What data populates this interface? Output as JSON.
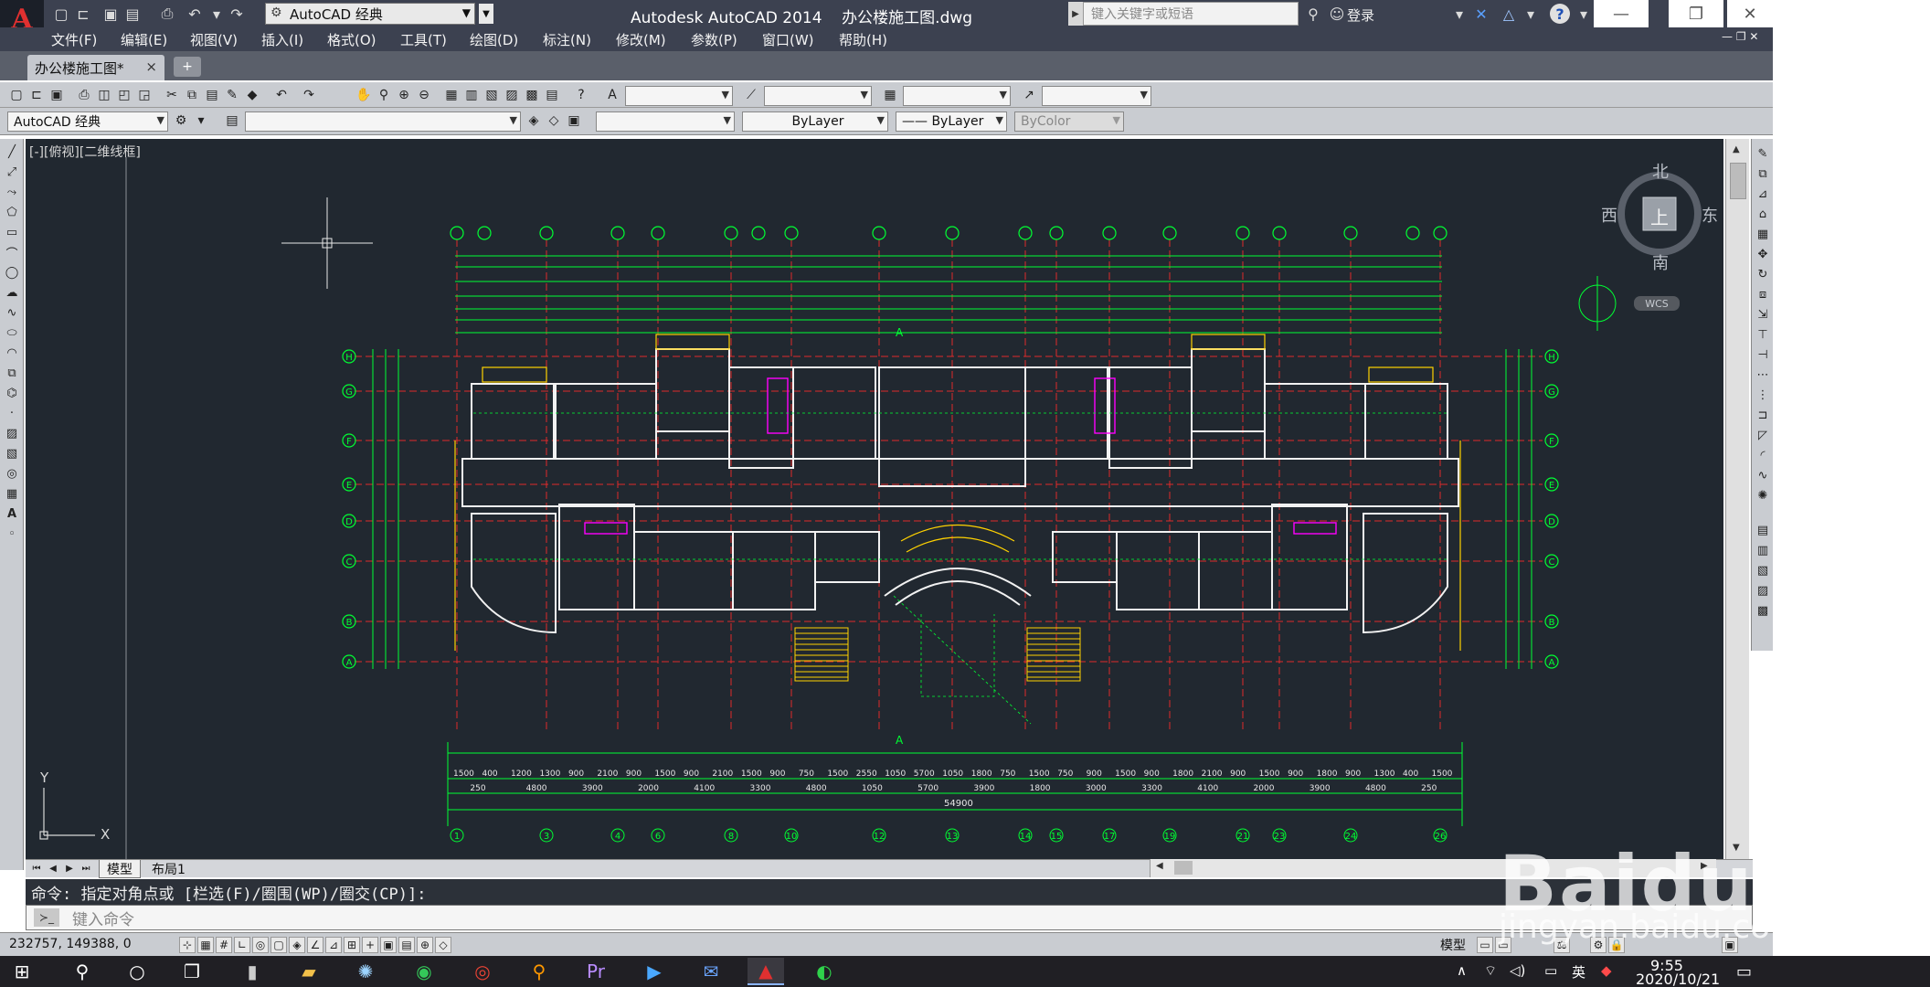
{
  "app": {
    "logo_letter": "A",
    "title": "Autodesk AutoCAD 2014    办公楼施工图.dwg",
    "workspace": "AutoCAD 经典",
    "search_placeholder": "键入关键字或短语",
    "login_label": "登录"
  },
  "menu": [
    "文件(F)",
    "编辑(E)",
    "视图(V)",
    "插入(I)",
    "格式(O)",
    "工具(T)",
    "绘图(D)",
    "标注(N)",
    "修改(M)",
    "参数(P)",
    "窗口(W)",
    "帮助(H)"
  ],
  "document_tab": {
    "name": "办公楼施工图*",
    "close": "×",
    "new_tab": "+"
  },
  "toolbar2": {
    "workspace": "AutoCAD 经典",
    "layer": "",
    "color": "",
    "linetype": "ByLayer",
    "lineweight": "—— ByLayer",
    "plotstyle": "ByColor"
  },
  "viewport": {
    "label": "[-][俯视][二维线框]",
    "compass": {
      "north": "北",
      "south": "南",
      "east": "东",
      "west": "西",
      "top": "上",
      "wcs": "WCS"
    },
    "ucs": {
      "x": "X",
      "y": "Y"
    }
  },
  "drawing": {
    "dim_row1": [
      "1500",
      "400",
      "1200",
      "1300",
      "900",
      "2100",
      "900",
      "1500",
      "900",
      "2100",
      "1500",
      "900",
      "750",
      "1500",
      "2550",
      "1050",
      "5700",
      "1050",
      "1800",
      "750",
      "1500",
      "750",
      "900",
      "1500",
      "900",
      "1800",
      "2100",
      "900",
      "1500",
      "900",
      "1800",
      "900",
      "1300",
      "400",
      "1500"
    ],
    "dim_row2": [
      "250",
      "4800",
      "3900",
      "2000",
      "4100",
      "3300",
      "4800",
      "1050",
      "5700",
      "3900",
      "1800",
      "3000",
      "3300",
      "4100",
      "2000",
      "3900",
      "4800",
      "250"
    ],
    "total_dim": "54900",
    "axis_labels": [
      "1",
      "3",
      "4",
      "6",
      "8",
      "10",
      "12",
      "13",
      "14",
      "15",
      "17",
      "19",
      "21",
      "23",
      "24",
      "26"
    ],
    "row_labels": [
      "H",
      "G",
      "F",
      "E",
      "D",
      "C",
      "B",
      "A"
    ],
    "section_label": "A"
  },
  "layout_tabs": [
    "模型",
    "布局1"
  ],
  "command": {
    "history": "命令: 指定对角点或 [栏选(F)/圈围(WP)/圈交(CP)]:",
    "placeholder": "键入命令"
  },
  "status": {
    "coords": "232757, 149388, 0",
    "model": "模型"
  },
  "taskbar": {
    "ime": "英",
    "time": "9:55",
    "date": "2020/10/21"
  },
  "watermark": {
    "main": "Baidu经验",
    "sub": "jingyan.baidu.com"
  },
  "colors": {
    "canvas": "#212830",
    "plan_green": "#00ff33",
    "plan_red": "#ff3030",
    "plan_yellow": "#ffd200",
    "plan_white": "#f2f2f2",
    "plan_magenta": "#ff00ff",
    "chrome_dark": "#3c4150"
  }
}
